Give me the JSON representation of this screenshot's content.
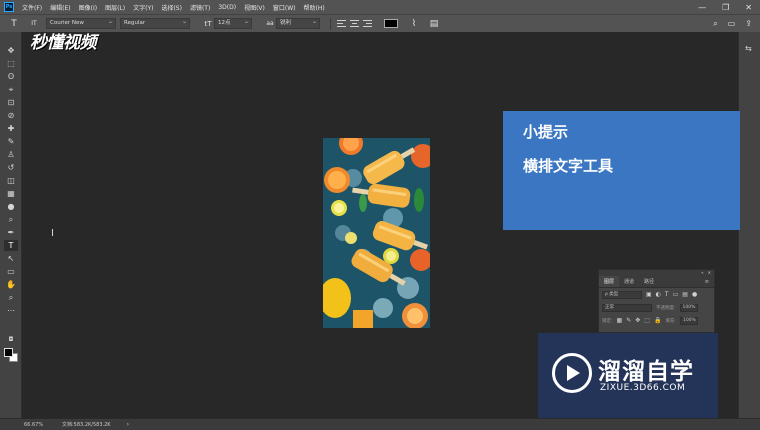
{
  "app": {
    "logo_text": "Ps"
  },
  "menu": {
    "items": [
      "文件(F)",
      "编辑(E)",
      "图像(I)",
      "图层(L)",
      "文字(Y)",
      "选择(S)",
      "滤镜(T)",
      "3D(D)",
      "视图(V)",
      "窗口(W)",
      "帮助(H)"
    ],
    "window_controls": [
      "—",
      "❐",
      "✕"
    ]
  },
  "options": {
    "tool_icon": "T",
    "orient_icon": "IT",
    "font_family": "Courier New",
    "font_style": "Regular",
    "size_icon": "tT",
    "font_size": "12点",
    "aa_icon": "aa",
    "antialias": "锐利",
    "text_color": "#000000",
    "right_icons": [
      "⌕",
      "▭",
      "⇪"
    ]
  },
  "tools": [
    "✥",
    "⬚",
    "ʘ",
    "⌖",
    "⊡",
    "⊘",
    "✚",
    "✎",
    "♙",
    "↺",
    "◫",
    "▦",
    "●",
    "⌕",
    "✒",
    "T",
    "↖",
    "▭",
    "✋",
    "⌕",
    "⋯"
  ],
  "colors": {
    "foreground": "#000000",
    "background": "#ffffff",
    "hint_bg": "#3a76c2"
  },
  "canvas": {
    "cursor_icon": "I"
  },
  "status": {
    "zoom": "66.67%",
    "doc_info": "文档:583.2K/583.2K",
    "arrow": "›"
  },
  "brand_text": "秒懂视频",
  "hint": {
    "title": "小提示",
    "body": "横排文字工具"
  },
  "layers_panel": {
    "tabs": [
      "图层",
      "通道",
      "路径"
    ],
    "active_tab": "图层",
    "filter_label": "ρ 类型",
    "blend_mode": "正常",
    "opacity_label": "不透明度:",
    "opacity_value": "100%",
    "lock_label": "锁定:",
    "fill_label": "填充:",
    "fill_value": "100%"
  },
  "watermark": {
    "name": "溜溜自学",
    "url": "ZIXUE.3D66.COM"
  }
}
